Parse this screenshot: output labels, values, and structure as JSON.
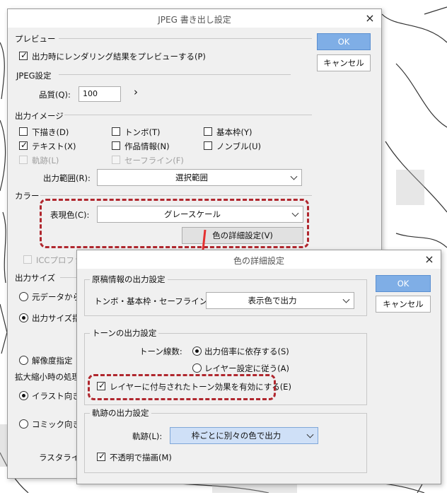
{
  "jpeg_dialog": {
    "title": "JPEG 書き出し設定",
    "close": "×",
    "ok": "OK",
    "cancel": "キャンセル",
    "preview_group": "プレビュー",
    "preview_render": "出力時にレンダリング結果をプレビューする(P)",
    "jpeg_group": "JPEG設定",
    "quality_label": "品質(Q):",
    "quality_value": "100",
    "quality_arrow": "›",
    "output_image_group": "出力イメージ",
    "draft": "下描き(D)",
    "tombo": "トンボ(T)",
    "base_frame": "基本枠(Y)",
    "text": "テキスト(X)",
    "work_info": "作品情報(N)",
    "nombre": "ノンブル(U)",
    "trajectory": "軌跡(L)",
    "safe_line": "セーフライン(F)",
    "output_range_label": "出力範囲(R):",
    "output_range_value": "選択範囲",
    "color_group": "カラー",
    "expression_color_label": "表現色(C):",
    "expression_color_value": "グレースケール",
    "color_detail_button": "色の詳細設定(V)",
    "icc_profile": "ICCプロファ",
    "output_size_group": "出力サイズ",
    "size_original": "元データから",
    "size_output": "出力サイズ指",
    "size_resolution": "解像度指定",
    "scale_group": "拡大縮小時の処理",
    "scale_illust": "イラスト向き(",
    "scale_comic": "コミック向き(",
    "rasterize": "ラスタライズ"
  },
  "color_dialog": {
    "title": "色の詳細設定",
    "close": "×",
    "ok": "OK",
    "cancel": "キャンセル",
    "manuscript_group": "原稿情報の出力設定",
    "tombo_label": "トンボ・基本枠・セーフライン(T):",
    "tombo_value": "表示色で出力",
    "tone_group": "トーンの出力設定",
    "tone_lines_label": "トーン線数:",
    "tone_depend_output": "出力倍率に依存する(S)",
    "tone_follow_layer": "レイヤー設定に従う(A)",
    "tone_enable_effect": "レイヤーに付与されたトーン効果を有効にする(E)",
    "trajectory_group": "軌跡の出力設定",
    "trajectory_label": "軌跡(L):",
    "trajectory_value": "枠ごとに別々の色で出力",
    "draw_opaque": "不透明で描画(M)"
  }
}
